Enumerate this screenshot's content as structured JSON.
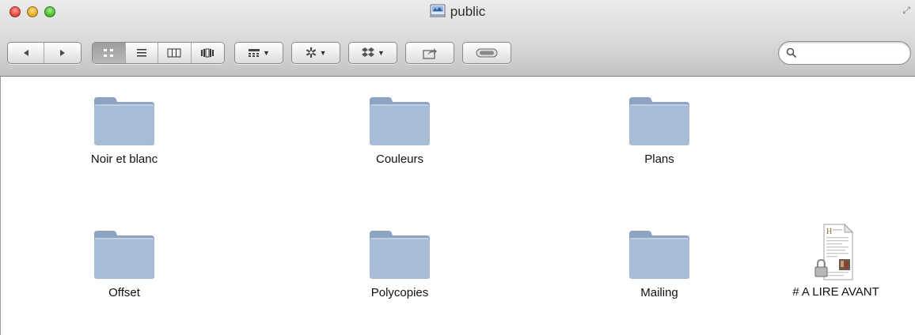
{
  "window": {
    "title": "public"
  },
  "toolbar": {
    "back": "back-arrow",
    "forward": "forward-arrow",
    "views": [
      "icon-view",
      "list-view",
      "column-view",
      "cover-flow-view"
    ],
    "arrange": "arrange-menu",
    "action": "action-gear-menu",
    "dropbox": "dropbox-menu",
    "share": "share",
    "toggle": "toggle-sidebar"
  },
  "search": {
    "placeholder": "",
    "value": ""
  },
  "items": [
    {
      "label": "Noir et blanc",
      "type": "folder"
    },
    {
      "label": "Couleurs",
      "type": "folder"
    },
    {
      "label": "Plans",
      "type": "folder"
    },
    {
      "label": "Offset",
      "type": "folder"
    },
    {
      "label": "Polycopies",
      "type": "folder"
    },
    {
      "label": "Mailing",
      "type": "folder"
    },
    {
      "label": "# A LIRE AVANT",
      "type": "locked-document"
    }
  ],
  "colors": {
    "folder": "#a9bcd6",
    "folderDark": "#8ea3c1",
    "red": "#e0443a",
    "yellow": "#e0a41d",
    "green": "#3fb52b"
  }
}
